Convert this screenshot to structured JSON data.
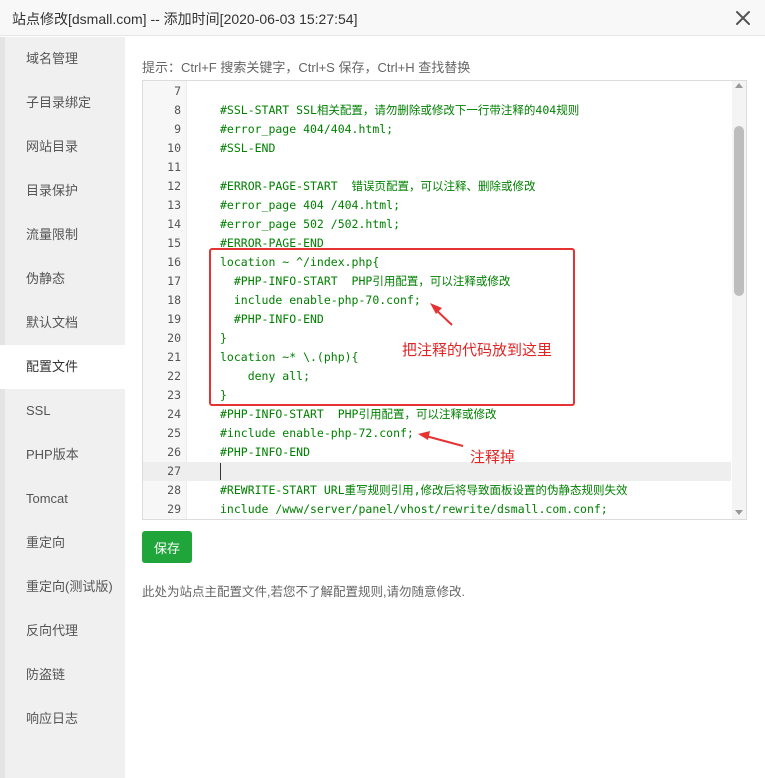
{
  "window": {
    "title": "站点修改[dsmall.com] -- 添加时间[2020-06-03 15:27:54]",
    "close_icon": "close-icon"
  },
  "sidebar": {
    "items": [
      {
        "label": "域名管理"
      },
      {
        "label": "子目录绑定"
      },
      {
        "label": "网站目录"
      },
      {
        "label": "目录保护"
      },
      {
        "label": "流量限制"
      },
      {
        "label": "伪静态"
      },
      {
        "label": "默认文档"
      },
      {
        "label": "配置文件",
        "active": true
      },
      {
        "label": "SSL"
      },
      {
        "label": "PHP版本"
      },
      {
        "label": "Tomcat"
      },
      {
        "label": "重定向"
      },
      {
        "label": "重定向(测试版)"
      },
      {
        "label": "反向代理"
      },
      {
        "label": "防盗链"
      },
      {
        "label": "响应日志"
      }
    ]
  },
  "main": {
    "hint": "提示：Ctrl+F 搜索关键字，Ctrl+S 保存，Ctrl+H 查找替换",
    "save_label": "保存",
    "note": "此处为站点主配置文件,若您不了解配置规则,请勿随意修改."
  },
  "editor": {
    "lines": [
      {
        "num": "7",
        "text": ""
      },
      {
        "num": "8",
        "text": "#SSL-START SSL相关配置，请勿删除或修改下一行带注释的404规则"
      },
      {
        "num": "9",
        "text": "#error_page 404/404.html;"
      },
      {
        "num": "10",
        "text": "#SSL-END"
      },
      {
        "num": "11",
        "text": ""
      },
      {
        "num": "12",
        "text": "#ERROR-PAGE-START  错误页配置，可以注释、删除或修改"
      },
      {
        "num": "13",
        "text": "#error_page 404 /404.html;"
      },
      {
        "num": "14",
        "text": "#error_page 502 /502.html;"
      },
      {
        "num": "15",
        "text": "#ERROR-PAGE-END"
      },
      {
        "num": "16",
        "text": "location ~ ^/index.php{"
      },
      {
        "num": "17",
        "text": "  #PHP-INFO-START  PHP引用配置，可以注释或修改"
      },
      {
        "num": "18",
        "text": "  include enable-php-70.conf;"
      },
      {
        "num": "19",
        "text": "  #PHP-INFO-END"
      },
      {
        "num": "20",
        "text": "}"
      },
      {
        "num": "21",
        "text": "location ~* \\.(php){"
      },
      {
        "num": "22",
        "text": "    deny all;"
      },
      {
        "num": "23",
        "text": "}"
      },
      {
        "num": "24",
        "text": "#PHP-INFO-START  PHP引用配置，可以注释或修改"
      },
      {
        "num": "25",
        "text": "#include enable-php-72.conf;"
      },
      {
        "num": "26",
        "text": "#PHP-INFO-END"
      },
      {
        "num": "27",
        "text": ""
      },
      {
        "num": "28",
        "text": "#REWRITE-START URL重写规则引用,修改后将导致面板设置的伪静态规则失效"
      },
      {
        "num": "29",
        "text": "include /www/server/panel/vhost/rewrite/dsmall.com.conf;"
      }
    ],
    "active_line": "27"
  },
  "annotations": {
    "box_note": "把注释的代码放到这里",
    "arrow_note": "注释掉",
    "color": "#e02424"
  },
  "colors": {
    "accent": "#20a53a",
    "comment": "#008000",
    "keyword": "#0000c8",
    "annotation": "#e53333"
  }
}
